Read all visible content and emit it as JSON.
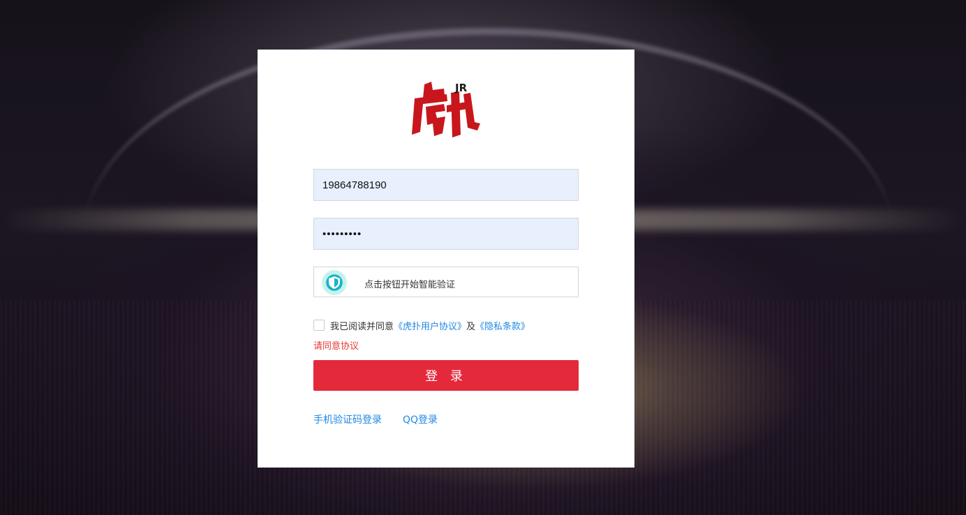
{
  "logo": {
    "brand_text": "虎扑",
    "badge_text": "JR",
    "color": "#c8161d"
  },
  "form": {
    "username_value": "19864788190",
    "password_value": "•••••••••",
    "captcha_label": "点击按钮开始智能验证",
    "agreement": {
      "prefix": "我已阅读并同意",
      "user_agreement": "《虎扑用户协议》",
      "joiner": "及",
      "privacy": "《隐私条款》"
    },
    "error_message": "请同意协议",
    "login_button": "登 录",
    "sms_login_link": "手机验证码登录",
    "qq_login_link": "QQ登录"
  },
  "colors": {
    "accent_red": "#e3293a",
    "link_blue": "#1e88e5",
    "error_red": "#e53935",
    "field_bg": "#e8f0fe"
  },
  "icons": {
    "captcha": "shield-icon",
    "logo": "hupu-logo"
  }
}
